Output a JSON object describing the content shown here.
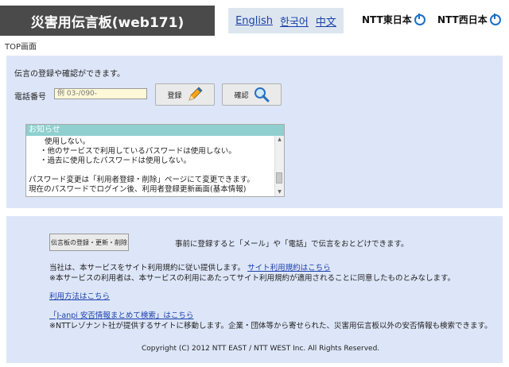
{
  "header": {
    "title": "災害用伝言板(web171)",
    "languages": [
      "English",
      "한국어",
      "中文"
    ],
    "ntt_east": "NTT東日本",
    "ntt_west": "NTT西日本"
  },
  "breadcrumb": "TOP画面",
  "main": {
    "intro": "伝言の登録や確認ができます。",
    "phone_label": "電話番号",
    "phone_placeholder": "例 03-/090-",
    "register_label": "登録",
    "confirm_label": "確認"
  },
  "notice": {
    "heading": "お知らせ",
    "lines": [
      "使用しない。",
      "・他のサービスで利用しているパスワードは使用しない。",
      "・過去に使用したパスワードは使用しない。",
      "",
      "パスワード変更は「利用者登録・削除」ページにて変更できます。",
      "現在のパスワードでログイン後、利用者登録更新画面(基本情報)"
    ]
  },
  "footer": {
    "reg_button": "伝言板の登録・更新・削除",
    "reg_desc": "事前に登録すると「メール」や「電話」で伝言をおとどけできます。",
    "terms_text": "当社は、本サービスをサイト利用規約に従い提供します。",
    "terms_link": "サイト利用規約はこちら",
    "terms_note": "※本サービスの利用者は、本サービスの利用にあたってサイト利用規約が適用されることに同意したものとみなします。",
    "howto_link": "利用方法はこちら",
    "janpi_link": "「J-anpi 安否情報まとめて検索」はこちら",
    "janpi_note": "※NTTレゾナント社が提供するサイトに移動します。企業・団体等から寄せられた、災害用伝言板以外の安否情報も検索できます。",
    "copyright": "Copyright (C) 2012 NTT EAST / NTT WEST Inc. All Rights Reserved."
  },
  "colors": {
    "panel": "#dde6f8",
    "header_dark": "#4a4a4a",
    "link": "#1a3faa",
    "notice_head": "#8fcfcf"
  }
}
